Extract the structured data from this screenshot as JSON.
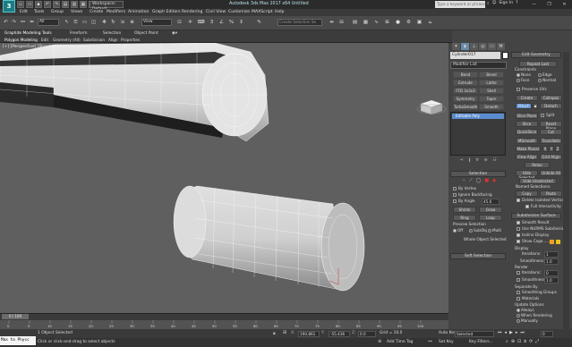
{
  "app": {
    "logo_text": "3",
    "title": "Autodesk 3ds Max 2017 x64     Untitled",
    "workspace": "Workspace: Default",
    "search_placeholder": "Type a keyword or phrase",
    "sign_in": "Sign In"
  },
  "menu": [
    "Edit",
    "Tools",
    "Group",
    "Views",
    "Create",
    "Modifiers",
    "Animation",
    "Graph Editors",
    "Rendering",
    "Civil View",
    "Customize",
    "MAXScript",
    "Help"
  ],
  "toolbar": {
    "filter": "All",
    "ref_coord": "View",
    "create_selection_set": "Create Selection Se"
  },
  "ribbon": {
    "tabs": [
      "Graphite Modeling Tools",
      "Freeform",
      "Selection",
      "Object Paint"
    ],
    "subtabs": [
      "Polygon Modeling",
      "Edit",
      "Geometry (All)",
      "Subdivision",
      "Align",
      "Properties"
    ]
  },
  "viewport": {
    "label": "[+] [Perspective] [Standard] [Edged Faces]"
  },
  "command_panel": {
    "tab_icons": [
      "create-icon",
      "modify-icon",
      "hierarchy-icon",
      "motion-icon",
      "display-icon",
      "utilities-icon"
    ],
    "object_name": "Cylinder017",
    "object_color": "#ffffff",
    "modifier_list": "Modifier List",
    "modifier_buttons": [
      "Bend",
      "Bevel",
      "Extrude",
      "Lathe",
      "FFD 3x3x3",
      "Shell",
      "Symmetry",
      "Taper",
      "TurboSmooth",
      "Smooth"
    ],
    "stack_selected": "Editable Poly"
  },
  "selection": {
    "title": "Selection",
    "by_vertex": "By Vertex",
    "ignore_backfacing": "Ignore Backfacing",
    "by_angle": "By Angle",
    "angle_value": "45.0",
    "shrink": "Shrink",
    "grow": "Grow",
    "ring": "Ring",
    "loop": "Loop",
    "preview_title": "Preview Selection",
    "preview_off": "Off",
    "preview_subobj": "SubObj",
    "preview_multi": "Multi",
    "whole_selected": "Whole Object Selected",
    "soft_selection": "Soft Selection"
  },
  "edit_geometry": {
    "title": "Edit Geometry",
    "repeat_last": "Repeat Last",
    "constraints_label": "Constraints",
    "c_none": "None",
    "c_edge": "Edge",
    "c_face": "Face",
    "c_normal": "Normal",
    "preserve_uvs": "Preserve UVs",
    "create": "Create",
    "collapse": "Collapse",
    "attach": "Attach",
    "detach": "Detach",
    "slice_plane": "Slice Plane",
    "split": "Split",
    "slice": "Slice",
    "reset_plane": "Reset Plane",
    "quickslice": "QuickSlice",
    "cut": "Cut",
    "msmooth": "MSmooth",
    "tessellate": "Tessellate",
    "make_planar": "Make Planar",
    "x": "X",
    "y": "Y",
    "z": "Z",
    "view_align": "View Align",
    "grid_align": "Grid Align",
    "relax": "Relax",
    "hide_selected": "Hide Selected",
    "unhide_all": "Unhide All",
    "hide_unselected": "Hide Unselected",
    "named_selections": "Named Selections:",
    "copy": "Copy",
    "paste": "Paste",
    "delete_isolated": "Delete Isolated Vertices",
    "full_interactivity": "Full Interactivity"
  },
  "subdivision_surface": {
    "title": "Subdivision Surface",
    "smooth_result": "Smooth Result",
    "use_nurms": "Use NURMS Subdivision",
    "isoline_display": "Isoline Display",
    "show_cage": "Show Cage......",
    "cage_color_1": "#f0a020",
    "cage_color_2": "#e8c020",
    "display_label": "Display",
    "iterations_label": "Iterations:",
    "iterations_value": "1",
    "smoothness_label": "Smoothness:",
    "smoothness_value": "1.0",
    "render_label": "Render",
    "render_iterations": "0",
    "render_smoothness": "1.0",
    "separate_by": "Separate By",
    "smoothing_groups": "Smoothing Groups",
    "materials": "Materials",
    "update_options": "Update Options",
    "always": "Always",
    "when_rendering": "When Rendering",
    "manually": "Manually"
  },
  "timeline": {
    "slider": "0 / 100",
    "ticks": [
      "0",
      "5",
      "10",
      "15",
      "20",
      "25",
      "30",
      "35",
      "40",
      "45",
      "50",
      "55",
      "60",
      "65",
      "70",
      "75",
      "80",
      "85",
      "90",
      "95",
      "100"
    ]
  },
  "status": {
    "maxscript": "Max to Physc",
    "selected": "1 Object Selected",
    "prompt": "Click or click-and-drag to select objects",
    "x": "190.861",
    "y": "-55.436",
    "z": "0.0",
    "grid": "Grid = 10.0",
    "add_time_tag": "Add Time Tag",
    "auto_key": "Auto Key",
    "selected_dd": "Selected",
    "set_key": "Set Key",
    "key_filters": "Key Filters...",
    "frame": "0"
  }
}
